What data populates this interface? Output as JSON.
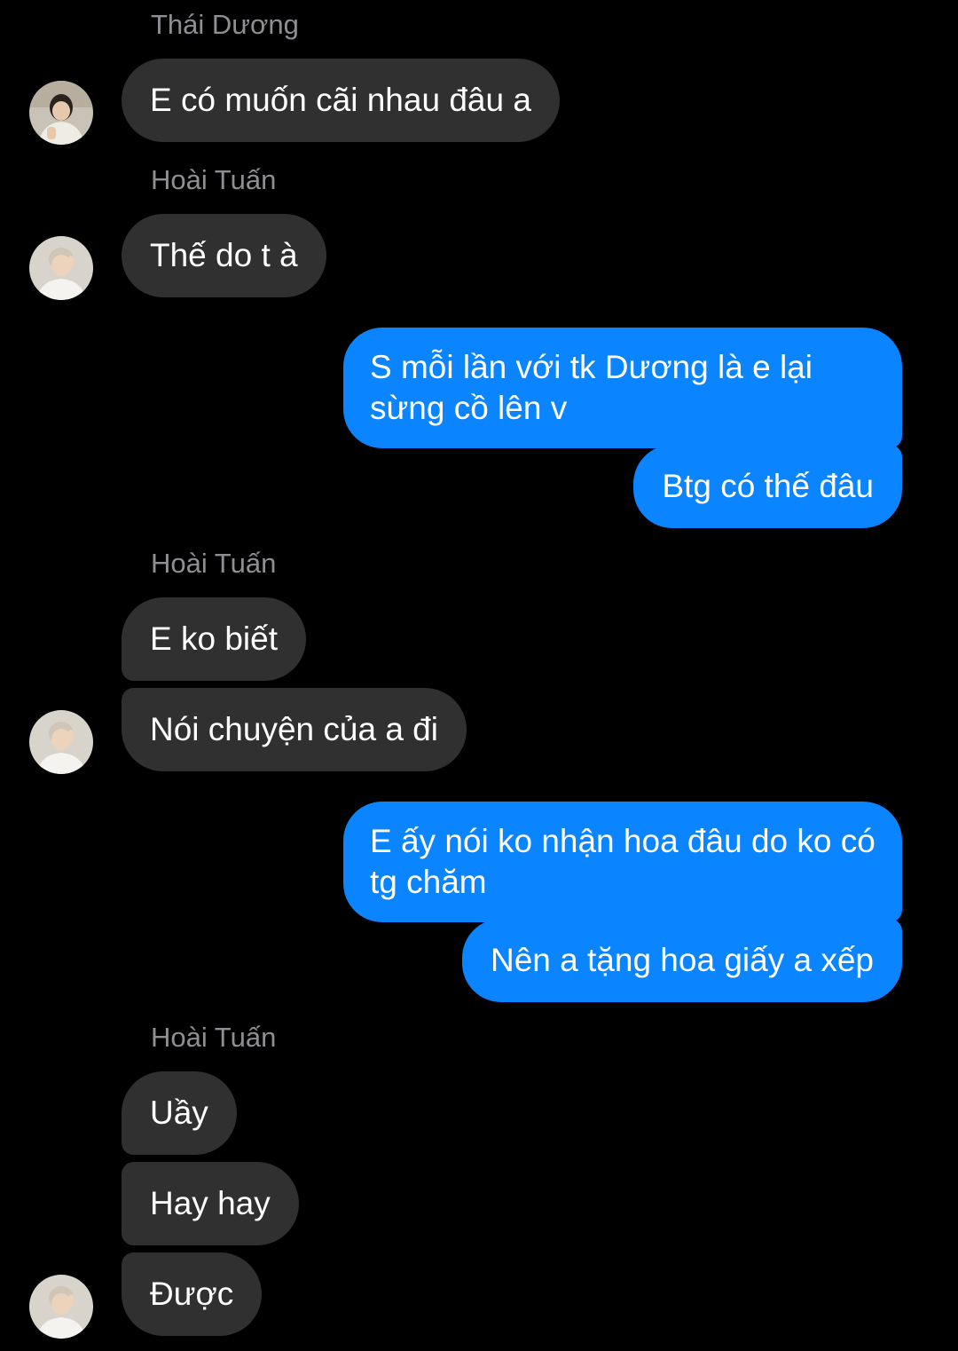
{
  "colors": {
    "background": "#000000",
    "incoming_bubble": "#303030",
    "outgoing_bubble": "#0a84ff",
    "sender_name": "#8e8e93"
  },
  "messages": [
    {
      "sender": "Thái Dương",
      "text": "E có muốn cãi nhau đâu a",
      "direction": "incoming",
      "avatar": "avatar-thai-duong"
    },
    {
      "sender": "Hoài Tuấn",
      "text": "Thế do t à",
      "direction": "incoming",
      "avatar": "avatar-hoai-tuan"
    },
    {
      "text": "S mỗi lần với tk Dương là e lại sừng cồ lên v",
      "direction": "outgoing"
    },
    {
      "text": "Btg có thế đâu",
      "direction": "outgoing"
    },
    {
      "sender": "Hoài Tuấn",
      "text": "E ko biết",
      "direction": "incoming"
    },
    {
      "text": "Nói chuyện của a đi",
      "direction": "incoming",
      "avatar": "avatar-hoai-tuan"
    },
    {
      "text": "E ấy nói ko nhận hoa đâu do ko có tg chăm",
      "direction": "outgoing"
    },
    {
      "text": "Nên a tặng hoa giấy a xếp",
      "direction": "outgoing"
    },
    {
      "sender": "Hoài Tuấn",
      "text": "Uầy",
      "direction": "incoming"
    },
    {
      "text": "Hay hay",
      "direction": "incoming"
    },
    {
      "text": "Được",
      "direction": "incoming",
      "avatar": "avatar-hoai-tuan"
    }
  ]
}
